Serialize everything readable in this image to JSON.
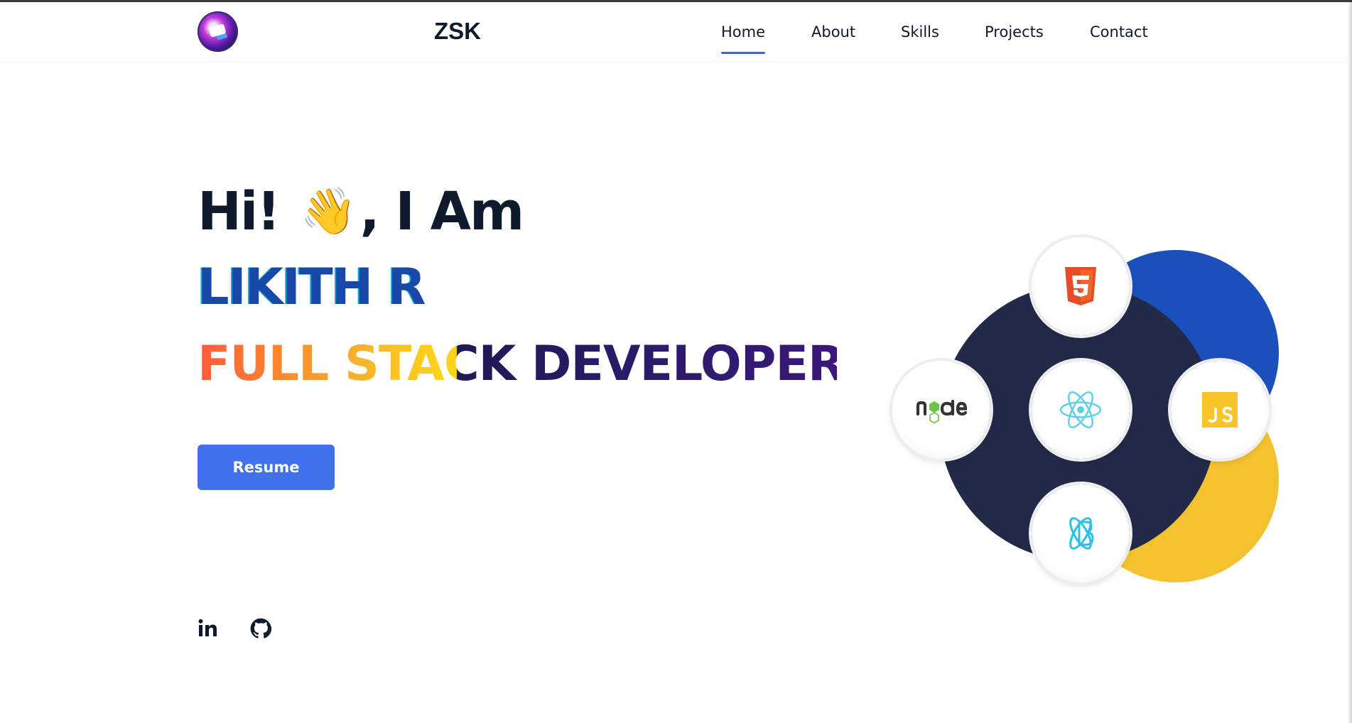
{
  "header": {
    "brand": "ZSK",
    "nav": [
      {
        "label": "Home",
        "active": true
      },
      {
        "label": "About",
        "active": false
      },
      {
        "label": "Skills",
        "active": false
      },
      {
        "label": "Projects",
        "active": false
      },
      {
        "label": "Contact",
        "active": false
      }
    ]
  },
  "hero": {
    "greeting_pre": "Hi!",
    "wave": "👋",
    "greeting_post": ", I Am",
    "name": "LIKITH R",
    "role": "FULL STACK DEVELOPER",
    "resume_label": "Resume"
  },
  "socials": [
    "linkedin-icon",
    "github-icon"
  ],
  "tech_icons": [
    "html5-icon",
    "react-icon",
    "nodejs-icon",
    "javascript-icon",
    "electron-icon"
  ],
  "colors": {
    "accent": "#4271ee",
    "name": "#1848a8",
    "dark_circle": "#232a48",
    "blue_circle": "#1b4fbb",
    "yellow_circle": "#f4c22e",
    "heading": "#0f1b2d"
  }
}
